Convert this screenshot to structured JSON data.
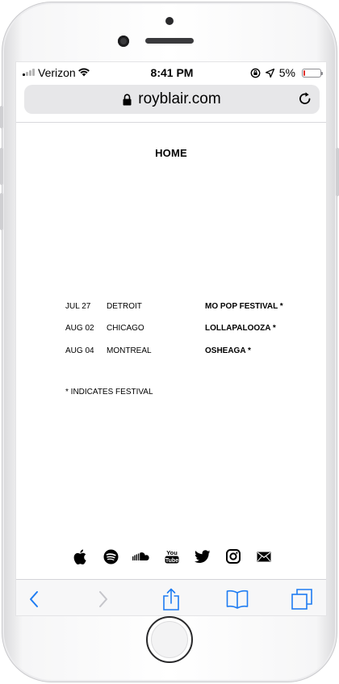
{
  "status_bar": {
    "carrier": "Verizon",
    "time": "8:41 PM",
    "battery_percent": "5%",
    "battery_level": 0.05,
    "signal_bars_active": 1,
    "signal_bars_total": 4
  },
  "browser": {
    "url": "royblair.com"
  },
  "page": {
    "heading": "HOME",
    "tour_dates": [
      {
        "date": "JUL 27",
        "city": "DETROIT",
        "event": "MO POP FESTIVAL *"
      },
      {
        "date": "AUG 02",
        "city": "CHICAGO",
        "event": "LOLLAPALOOZA *"
      },
      {
        "date": "AUG 04",
        "city": "MONTREAL",
        "event": "OSHEAGA *"
      }
    ],
    "footnote": "* INDICATES FESTIVAL",
    "social_links": [
      "apple-music",
      "spotify",
      "soundcloud",
      "youtube",
      "twitter",
      "instagram",
      "email"
    ]
  },
  "colors": {
    "accent_blue": "#1e7cf2",
    "battery_low": "#e0302b",
    "text": "#000000"
  }
}
